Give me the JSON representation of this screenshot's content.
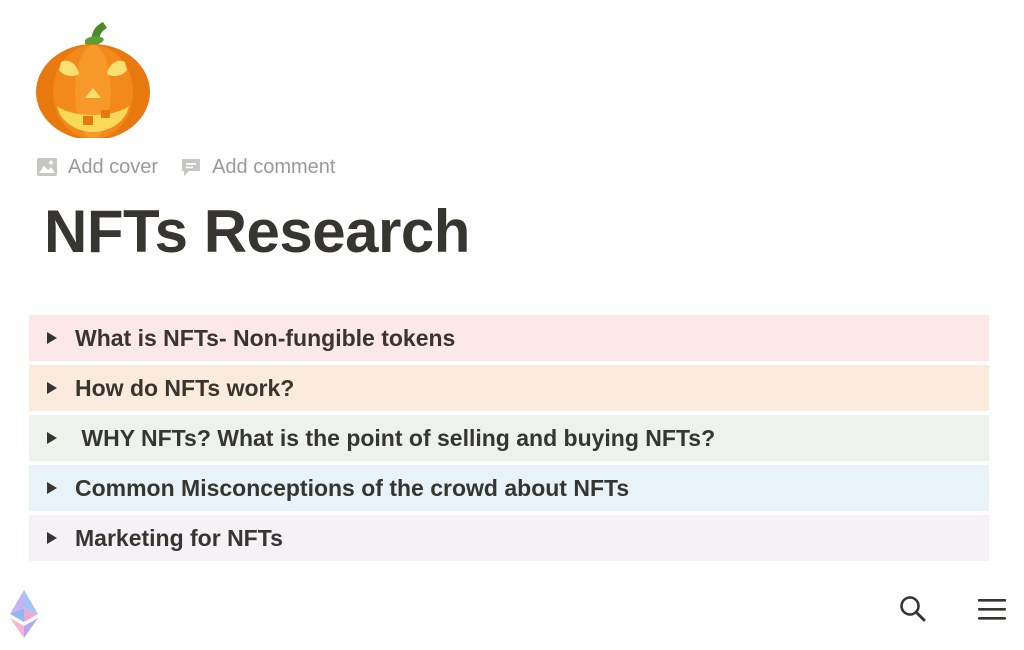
{
  "page": {
    "icon": "jack-o-lantern-icon",
    "title": "NFTs Research"
  },
  "meta_actions": {
    "add_cover": {
      "label": "Add cover",
      "icon": "image-icon"
    },
    "add_comment": {
      "label": "Add comment",
      "icon": "comment-icon"
    }
  },
  "toggles": [
    {
      "label": "What is NFTs- Non-fungible tokens",
      "color": "#fde8e8"
    },
    {
      "label": "How do NFTs work?",
      "color": "#faebdd"
    },
    {
      "label": " WHY NFTs? What is the point of selling and buying NFTs?",
      "color": "#edf3ec"
    },
    {
      "label": "Common Misconceptions of the crowd about NFTs",
      "color": "#e7f3f8"
    },
    {
      "label": "Marketing for NFTs",
      "color": "#f6f0f7"
    }
  ],
  "bottom_bar": {
    "logo": "ethereum-icon",
    "search": "search-icon",
    "menu": "hamburger-menu-icon"
  }
}
